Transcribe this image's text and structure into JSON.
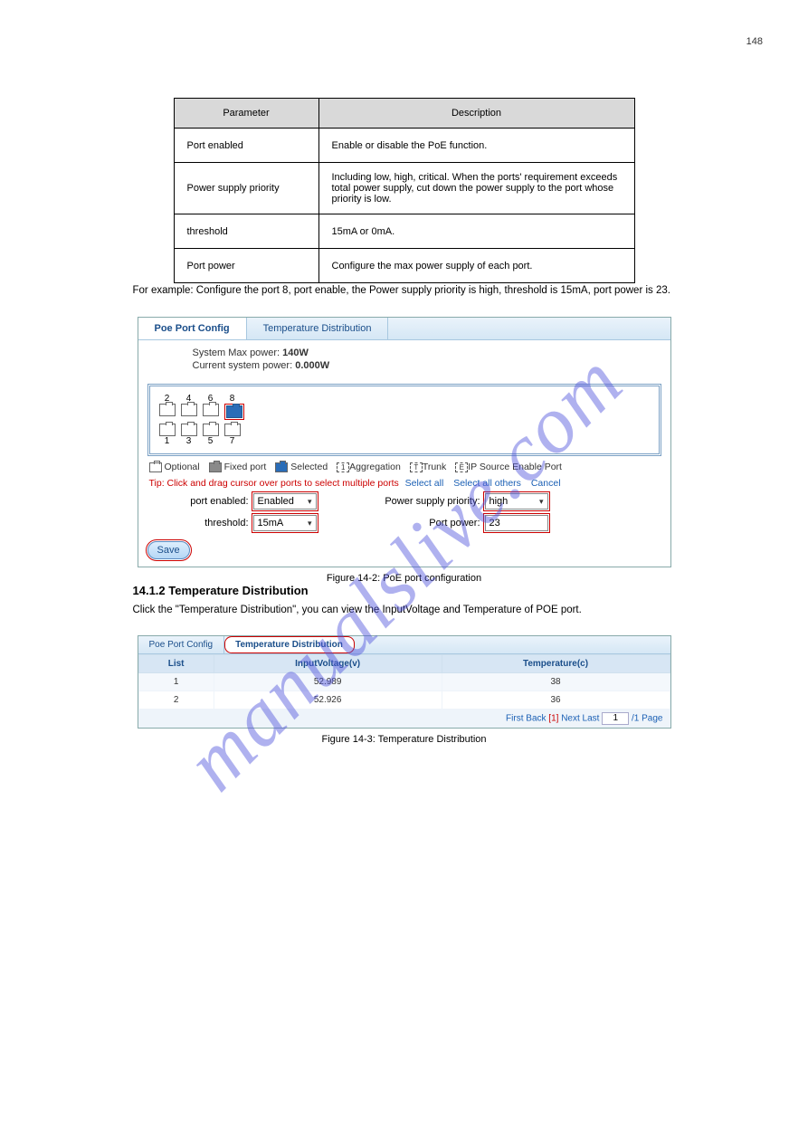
{
  "page_number": "148",
  "param_table": {
    "headers": [
      "Parameter",
      "Description"
    ],
    "rows": [
      [
        "Port enabled",
        "Enable or disable the PoE function."
      ],
      [
        "Power supply priority",
        "Including low, high, critical. When the ports' requirement exceeds total power supply, cut down the power supply to the port whose priority is low."
      ],
      [
        "threshold",
        "15mA or 0mA."
      ],
      [
        "Port power",
        "Configure the max power supply of each port."
      ]
    ]
  },
  "example_intro": "For example: Configure the port 8, port enable, the Power supply priority is high, threshold is 15mA, port power is 23.",
  "poe": {
    "tabs": {
      "config": "Poe Port Config",
      "temp": "Temperature Distribution"
    },
    "max_label": "System Max power:",
    "max_val": "140W",
    "cur_label": "Current system power:",
    "cur_val": "0.000W",
    "ports_top": [
      "2",
      "4",
      "6",
      "8"
    ],
    "ports_bottom": [
      "1",
      "3",
      "5",
      "7"
    ],
    "legend": {
      "optional": "Optional",
      "fixed": "Fixed port",
      "selected": "Selected",
      "agg": "Aggregation",
      "trunk": "Trunk",
      "ipsrc": "IP Source Enable Port",
      "agg_badge": "1",
      "trunk_badge": "T",
      "ip_badge": "E"
    },
    "tip_label": "Tip:",
    "tip_text": "Click and drag cursor over ports to select multiple ports",
    "links": {
      "selall": "Select all",
      "selothers": "Select all others",
      "cancel": "Cancel"
    },
    "fields": {
      "port_enabled_label": "port enabled:",
      "port_enabled_val": "Enabled",
      "priority_label": "Power supply priority:",
      "priority_val": "high",
      "threshold_label": "threshold:",
      "threshold_val": "15mA",
      "portpower_label": "Port power:",
      "portpower_val": "23"
    },
    "save": "Save"
  },
  "fig1_caption": "Figure 14-2: PoE port configuration",
  "section2": {
    "title": "14.1.2 Temperature Distribution",
    "intro": "Click the \"Temperature Distribution\", you can view the InputVoltage and Temperature of POE port."
  },
  "tempdist": {
    "tab_config": "Poe Port Config",
    "tab_temp": "Temperature Distribution",
    "headers": [
      "List",
      "InputVoltage(v)",
      "Temperature(c)"
    ],
    "rows": [
      [
        "1",
        "52.989",
        "38"
      ],
      [
        "2",
        "52.926",
        "36"
      ]
    ],
    "pager": {
      "first": "First",
      "back": "Back",
      "one": "[1]",
      "next": "Next",
      "last": "Last",
      "pagein": "1",
      "suffix": "/1 Page"
    }
  },
  "fig2_caption": "Figure 14-3: Temperature Distribution",
  "watermark": "manualslive.com"
}
